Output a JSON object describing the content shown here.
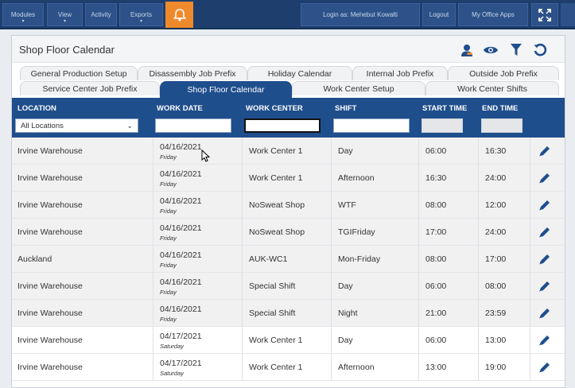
{
  "nav": {
    "buttons": [
      "Modules",
      "View",
      "Activity",
      "Exports"
    ],
    "login_text": "Login as: Mehebut Kowalti",
    "logout": "Logout",
    "office_apps": "My Office Apps"
  },
  "panel": {
    "title": "Shop Floor Calendar"
  },
  "tabs": {
    "row1": [
      "General Production Setup",
      "Disassembly Job Prefix",
      "Holiday Calendar",
      "Internal Job Prefix",
      "Outside Job Prefix"
    ],
    "row2": [
      "Service Center Job Prefix",
      "Shop Floor Calendar",
      "Work Center Setup",
      "Work Center Shifts"
    ]
  },
  "columns": [
    "LOCATION",
    "WORK DATE",
    "WORK CENTER",
    "SHIFT",
    "START TIME",
    "END TIME"
  ],
  "filters": {
    "location_selected": "All Locations"
  },
  "rows": [
    {
      "location": "Irvine Warehouse",
      "date": "04/16/2021",
      "day": "Friday",
      "center": "Work Center 1",
      "shift": "Day",
      "start": "06:00",
      "end": "16:30"
    },
    {
      "location": "Irvine Warehouse",
      "date": "04/16/2021",
      "day": "Friday",
      "center": "Work Center 1",
      "shift": "Afternoon",
      "start": "16:30",
      "end": "24:00"
    },
    {
      "location": "Irvine Warehouse",
      "date": "04/16/2021",
      "day": "Friday",
      "center": "NoSweat Shop",
      "shift": "WTF",
      "start": "08:00",
      "end": "12:00"
    },
    {
      "location": "Irvine Warehouse",
      "date": "04/16/2021",
      "day": "Friday",
      "center": "NoSweat Shop",
      "shift": "TGIFriday",
      "start": "17:00",
      "end": "24:00"
    },
    {
      "location": "Auckland",
      "date": "04/16/2021",
      "day": "Friday",
      "center": "AUK-WC1",
      "shift": "Mon-Friday",
      "start": "08:00",
      "end": "17:00"
    },
    {
      "location": "Irvine Warehouse",
      "date": "04/16/2021",
      "day": "Friday",
      "center": "Special Shift",
      "shift": "Day",
      "start": "06:00",
      "end": "08:00"
    },
    {
      "location": "Irvine Warehouse",
      "date": "04/16/2021",
      "day": "Friday",
      "center": "Special Shift",
      "shift": "Night",
      "start": "21:00",
      "end": "23:59"
    },
    {
      "location": "Irvine Warehouse",
      "date": "04/17/2021",
      "day": "Saturday",
      "center": "Work Center 1",
      "shift": "Day",
      "start": "06:00",
      "end": "13:00"
    },
    {
      "location": "Irvine Warehouse",
      "date": "04/17/2021",
      "day": "Saturday",
      "center": "Work Center 1",
      "shift": "Afternoon",
      "start": "13:00",
      "end": "19:00"
    }
  ],
  "colors": {
    "nav_bg": "#1e3f6e",
    "accent_orange": "#ef8a2c",
    "header_blue": "#1f4e8c",
    "icon_blue": "#1f4e8c"
  }
}
